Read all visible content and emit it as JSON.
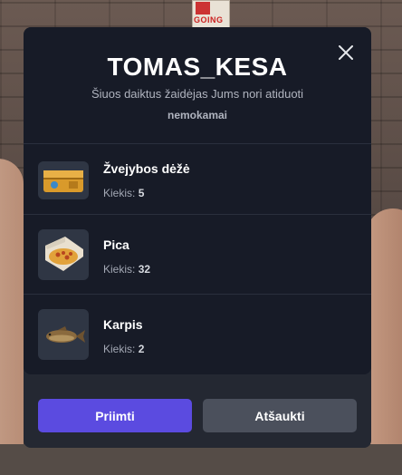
{
  "dialog": {
    "title": "TOMAS_KESA",
    "subtitle": "Šiuos daiktus žaidėjas Jums nori atiduoti",
    "subtitle_bold": "nemokamai",
    "close_icon": "close-icon",
    "quantity_label": "Kiekis:"
  },
  "items": [
    {
      "name": "Žvejybos dėžė",
      "quantity": "5",
      "icon": "tackle-box-icon"
    },
    {
      "name": "Pica",
      "quantity": "32",
      "icon": "pizza-icon"
    },
    {
      "name": "Karpis",
      "quantity": "2",
      "icon": "carp-fish-icon"
    }
  ],
  "buttons": {
    "accept": "Priimti",
    "cancel": "Atšaukti"
  },
  "background": {
    "sign_text": "GOING"
  },
  "colors": {
    "accent": "#5b4be0",
    "panel": "#171b27",
    "cancel": "#4b505c"
  }
}
